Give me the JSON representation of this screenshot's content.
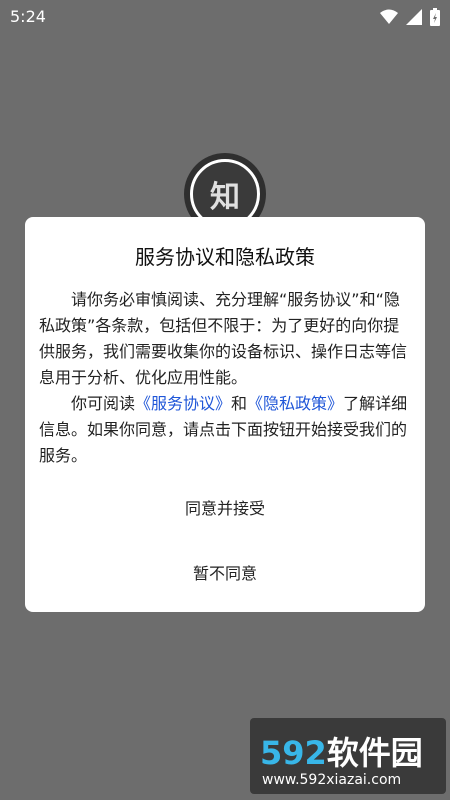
{
  "status_bar": {
    "time": "5:24"
  },
  "logo": {
    "text": "知"
  },
  "dialog": {
    "title": "服务协议和隐私政策",
    "paragraph1": "请你务必审慎阅读、充分理解“服务协议”和“隐私政策”各条款，包括但不限于：为了更好的向你提供服务，我们需要收集你的设备标识、操作日志等信息用于分析、优化应用性能。",
    "paragraph2_prefix": "你可阅读",
    "link_service": "《服务协议》",
    "paragraph2_and": "和",
    "link_privacy": "《隐私政策》",
    "paragraph2_suffix": "了解详细信息。如果你同意，请点击下面按钮开始接受我们的服务。",
    "agree_label": "同意并接受",
    "disagree_label": "暂不同意",
    "link_color": "#1f56d8"
  },
  "watermark": {
    "number": "592",
    "title": "软件园",
    "url": "www.592xiazai.com"
  }
}
